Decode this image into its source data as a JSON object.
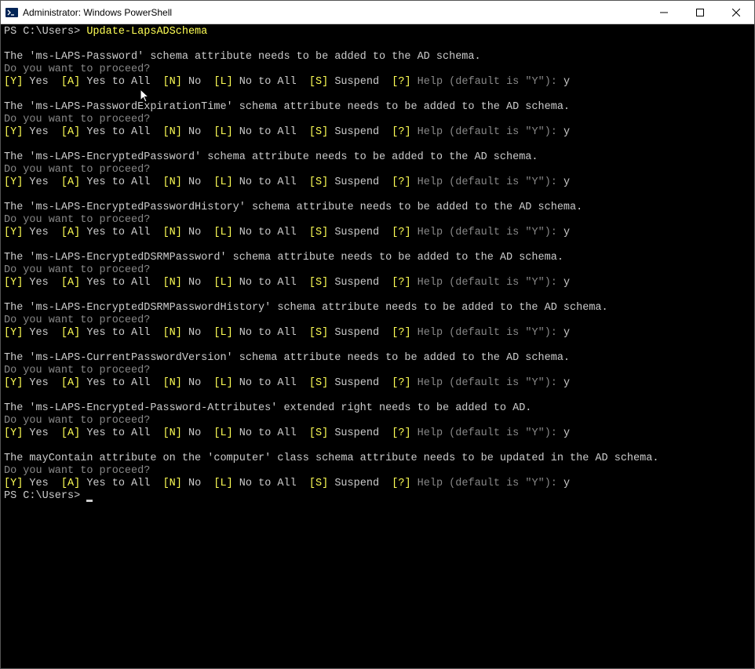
{
  "window": {
    "title": "Administrator: Windows PowerShell"
  },
  "terminal": {
    "prompt_path": "PS C:\\Users>",
    "command": "Update-LapsADSchema",
    "proceed_text": "Do you want to proceed?",
    "options": {
      "y_key": "[Y]",
      "y_txt": "Yes",
      "a_key": "[A]",
      "a_txt": "Yes to All",
      "n_key": "[N]",
      "n_txt": "No",
      "l_key": "[L]",
      "l_txt": "No to All",
      "s_key": "[S]",
      "s_txt": "Suspend",
      "q_key": "[?]",
      "q_txt": "Help (default is \"Y\"):"
    },
    "response": "y",
    "blocks": [
      "The 'ms-LAPS-Password' schema attribute needs to be added to the AD schema.",
      "The 'ms-LAPS-PasswordExpirationTime' schema attribute needs to be added to the AD schema.",
      "The 'ms-LAPS-EncryptedPassword' schema attribute needs to be added to the AD schema.",
      "The 'ms-LAPS-EncryptedPasswordHistory' schema attribute needs to be added to the AD schema.",
      "The 'ms-LAPS-EncryptedDSRMPassword' schema attribute needs to be added to the AD schema.",
      "The 'ms-LAPS-EncryptedDSRMPasswordHistory' schema attribute needs to be added to the AD schema.",
      "The 'ms-LAPS-CurrentPasswordVersion' schema attribute needs to be added to the AD schema.",
      "The 'ms-LAPS-Encrypted-Password-Attributes' extended right needs to be added to AD.",
      "The mayContain attribute on the 'computer' class schema attribute needs to be updated in the AD schema."
    ],
    "final_prompt": "PS C:\\Users>"
  }
}
